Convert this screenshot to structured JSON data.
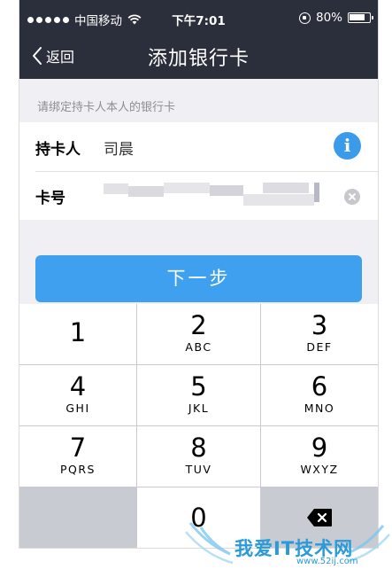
{
  "status_bar": {
    "carrier": "中国移动",
    "time": "下午7:01",
    "battery_percent": "80%",
    "battery_level": 0.8
  },
  "nav": {
    "back_label": "返回",
    "title": "添加银行卡"
  },
  "form": {
    "hint": "请绑定持卡人本人的银行卡",
    "holder_label": "持卡人",
    "holder_value": "司晨",
    "info_icon_glyph": "i",
    "card_label": "卡号"
  },
  "next_button": {
    "label": "下一步"
  },
  "keypad": {
    "keys": [
      {
        "num": "1",
        "letters": ""
      },
      {
        "num": "2",
        "letters": "ABC"
      },
      {
        "num": "3",
        "letters": "DEF"
      },
      {
        "num": "4",
        "letters": "GHI"
      },
      {
        "num": "5",
        "letters": "JKL"
      },
      {
        "num": "6",
        "letters": "MNO"
      },
      {
        "num": "7",
        "letters": "PQRS"
      },
      {
        "num": "8",
        "letters": "TUV"
      },
      {
        "num": "9",
        "letters": "WXYZ"
      },
      {
        "num": "0",
        "letters": ""
      }
    ],
    "delete_icon": "backspace-icon"
  },
  "watermark": {
    "text": "我爱IT技术网",
    "url": "www.52ij.com"
  },
  "colors": {
    "nav_bg": "#2b2e3b",
    "accent": "#3fa0f0",
    "info_blue": "#3a9bea",
    "page_bg": "#efeff4",
    "keypad_bg": "#c9cbd2"
  }
}
